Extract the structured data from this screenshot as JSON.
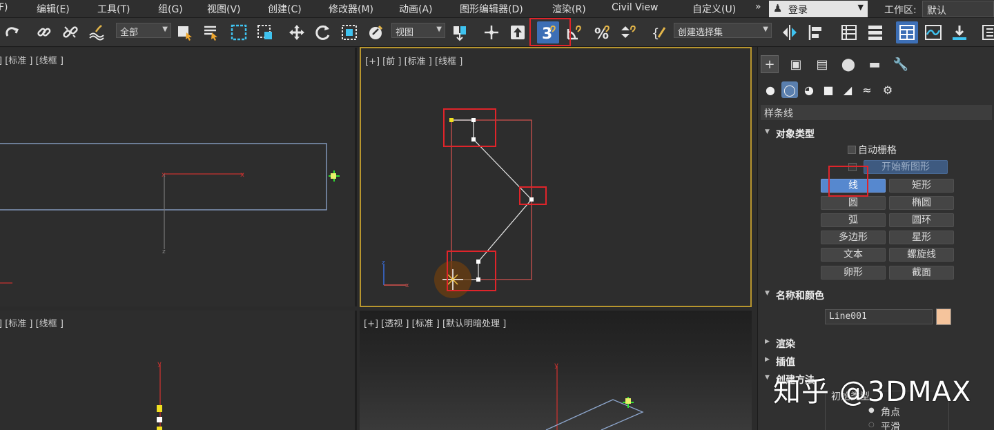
{
  "menubar": {
    "items": [
      "F)",
      "编辑(E)",
      "工具(T)",
      "组(G)",
      "视图(V)",
      "创建(C)",
      "修改器(M)",
      "动画(A)",
      "图形编辑器(D)",
      "渲染(R)",
      "Civil View",
      "自定义(U)"
    ],
    "chevron": "»",
    "login": "登录",
    "workspace_label": "工作区:",
    "workspace_value": "默认"
  },
  "toolbar": {
    "selection_filter": "全部",
    "ref_coord": "视图",
    "snap_toggle": "3",
    "named_selection": "创建选择集",
    "icons": [
      "redo-icon",
      "link-icon",
      "unlink-icon",
      "bind-spacewarp-icon",
      "select-object-icon",
      "select-by-name-icon",
      "rect-region-icon",
      "window-crossing-icon",
      "move-icon",
      "rotate-icon",
      "scale-icon",
      "placement-icon",
      "mirror-icon",
      "align-icon",
      "snap-3d-icon",
      "angle-snap-icon",
      "percent-snap-icon",
      "spinner-snap-icon",
      "edit-named-sel-icon",
      "layer-explorer-icon",
      "graphite-icon",
      "scene-explorer-icon",
      "layer-manager-icon",
      "ribbon-icon",
      "curve-editor-icon",
      "schematic-icon"
    ]
  },
  "viewports": {
    "top_left": "] [标准 ] [线框 ]",
    "top_right": "[+] [前 ] [标准 ] [线框 ]",
    "bottom_left": "] [标准 ] [线框 ]",
    "bottom_right": "[+] [透视 ] [标准 ] [默认明暗处理 ]"
  },
  "panel": {
    "category": "样条线",
    "object_type_title": "对象类型",
    "autogrid": "自动栅格",
    "start_new_shape": "开始新图形",
    "buttons": [
      [
        "线",
        "矩形"
      ],
      [
        "圆",
        "椭圆"
      ],
      [
        "弧",
        "圆环"
      ],
      [
        "多边形",
        "星形"
      ],
      [
        "文本",
        "螺旋线"
      ],
      [
        "卵形",
        "截面"
      ]
    ],
    "name_color_title": "名称和颜色",
    "object_name": "Line001",
    "object_color": "#f5c49c",
    "rollouts": [
      "渲染",
      "插值",
      "创建方法"
    ],
    "initial_type_label": "初始类型",
    "radio_corner": "角点",
    "radio_smooth": "平滑"
  },
  "watermark": "知乎 @3DMAX",
  "colors": {
    "highlight_red": "#e0242a",
    "active_blue": "#5688cf",
    "active_viewport_border": "#b8962e"
  }
}
